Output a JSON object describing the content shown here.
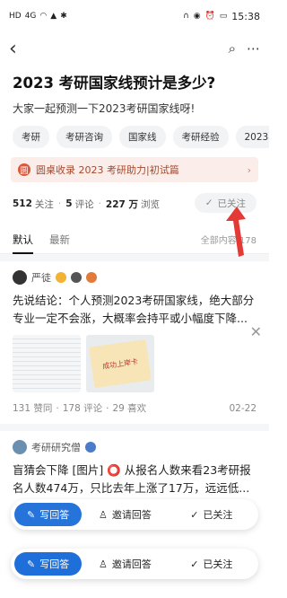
{
  "status": {
    "time": "15:38",
    "left_glyphs": [
      "HD",
      "4G",
      "wifi",
      "nav",
      "bt"
    ],
    "right_glyphs": [
      "headphones",
      "eye",
      "alarm",
      "battery"
    ]
  },
  "nav": {
    "back_icon": "back-arrow-icon",
    "search_icon": "search-icon",
    "more_icon": "more-dots-icon"
  },
  "question": {
    "title": "2023 考研国家线预计是多少?",
    "subtitle": "大家一起预测一下2023考研国家线呀!",
    "tags": [
      "考研",
      "考研咨询",
      "国家线",
      "考研经验",
      "2023考研"
    ],
    "banner": "圆桌收录 2023 考研助力|初试篇",
    "banner_seal": "圆",
    "banner_arrow": "›",
    "stats": {
      "followers": "512",
      "followers_label": "关注",
      "comments": "5",
      "comments_label": "评论",
      "views": "227 万",
      "views_label": "浏览"
    },
    "followed_label": "已关注"
  },
  "tabs": {
    "items": [
      "默认",
      "最新"
    ],
    "count_label": "全部内容 178"
  },
  "answers": [
    {
      "author": "严徒",
      "excerpt": "先说结论：个人预测2023考研国家线，绝大部分专业一定不会涨，大概率会持平或小幅度下降...",
      "thumb_note": "成功上岸卡",
      "upvotes": "131 赞同",
      "comments": "178 评论",
      "likes": "29 喜欢",
      "date": "02-22"
    },
    {
      "author": "考研研究僧",
      "excerpt": "盲猜会下降 [图片] ⭕ 从报名人数来看23考研报名人数474万，只比去年上涨了17万，远远低..."
    }
  ],
  "float_bar": {
    "answer_label": "写回答",
    "invite_label": "邀请回答",
    "followed_label": "已关注"
  },
  "colors": {
    "accent": "#1e6fd9",
    "banner_bg": "#fbeeea",
    "banner_text": "#a5492e",
    "callout": "#e53935"
  }
}
